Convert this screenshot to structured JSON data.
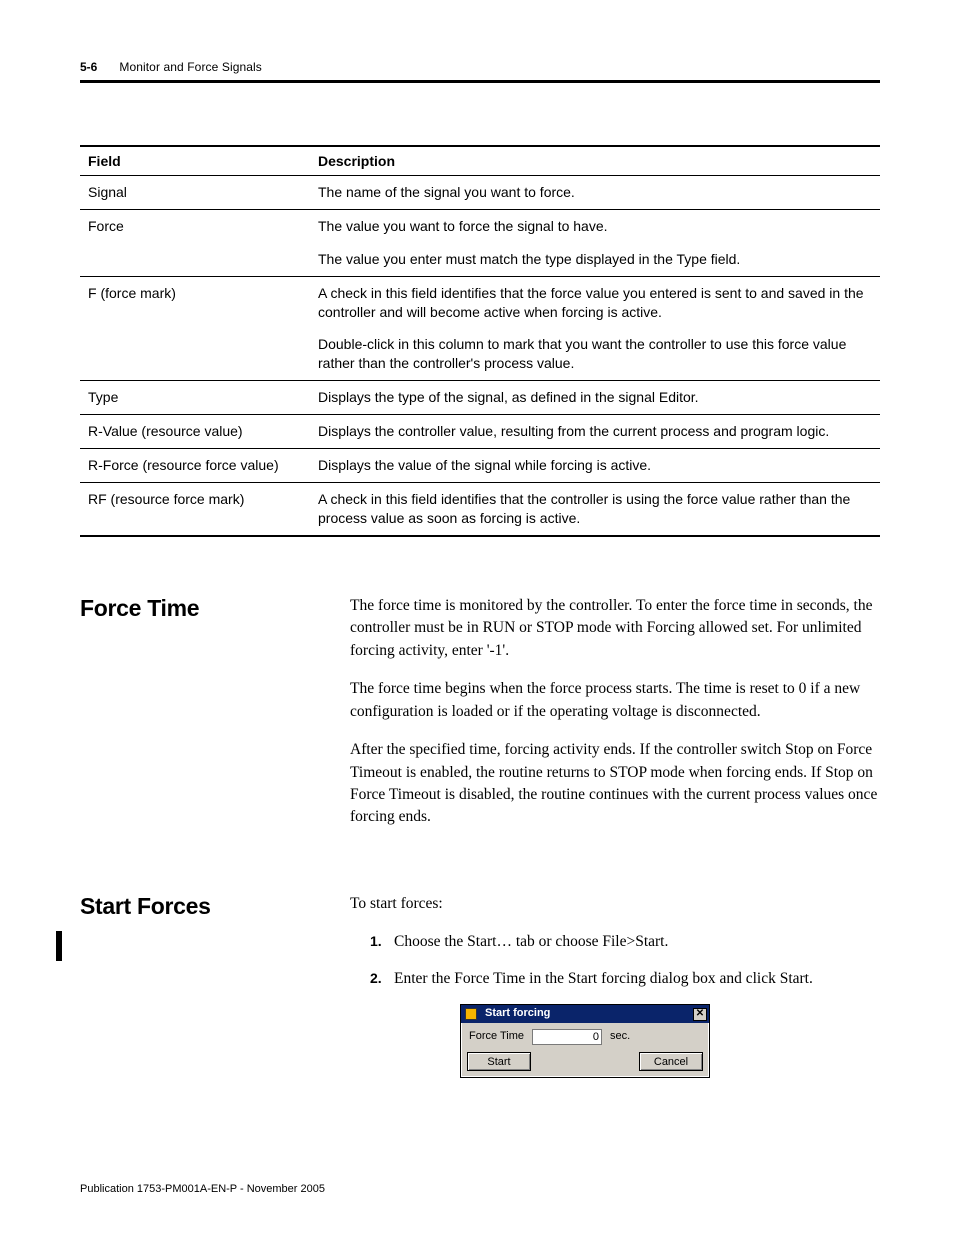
{
  "header": {
    "page_num": "5-6",
    "section": "Monitor and Force Signals"
  },
  "table": {
    "col_field": "Field",
    "col_desc": "Description",
    "rows": [
      {
        "field": "Signal",
        "desc": "The name of the signal you want to force."
      },
      {
        "field": "Force",
        "desc": "The value you want to force the signal to have.",
        "desc2": "The value you enter must match the type displayed in the Type field."
      },
      {
        "field": "F (force mark)",
        "desc": "A check in this field identifies that the force value you entered is sent to and saved in the controller and will become active when forcing is active.",
        "desc2": "Double-click in this column to mark that you want the controller to use this force value rather than the controller's process value."
      },
      {
        "field": "Type",
        "desc": "Displays the type of the signal, as defined in the signal Editor."
      },
      {
        "field": "R-Value (resource value)",
        "desc": "Displays the controller value, resulting from the current process and program logic."
      },
      {
        "field": "R-Force (resource force value)",
        "desc": "Displays the value of the signal while forcing is active."
      },
      {
        "field": "RF (resource force mark)",
        "desc": "A check in this field identifies that the controller is using the force value rather than the process value as soon as forcing is active."
      }
    ]
  },
  "force_time": {
    "heading": "Force Time",
    "p1": "The force time is monitored by the controller. To enter the force time in seconds, the controller must be in RUN or STOP mode with Forcing allowed set. For unlimited forcing activity, enter '-1'.",
    "p2": "The force time begins when the force process starts. The time is reset to 0 if a new configuration is loaded or if the operating voltage is disconnected.",
    "p3": "After the specified time, forcing activity ends. If the controller switch Stop on Force Timeout is enabled, the routine returns to STOP mode when forcing ends. If Stop on Force Timeout is disabled, the routine continues with the current process values once forcing ends."
  },
  "start_forces": {
    "heading": "Start Forces",
    "intro": "To start forces:",
    "steps": [
      "Choose the Start… tab or choose File>Start.",
      "Enter the Force Time in the Start forcing dialog box and click Start."
    ],
    "numbers": [
      "1.",
      "2."
    ]
  },
  "dialog": {
    "title": "Start forcing",
    "label": "Force Time",
    "value": "0",
    "unit": "sec.",
    "start": "Start",
    "cancel": "Cancel",
    "close_x": "✕"
  },
  "footer": "Publication 1753-PM001A-EN-P - November 2005"
}
